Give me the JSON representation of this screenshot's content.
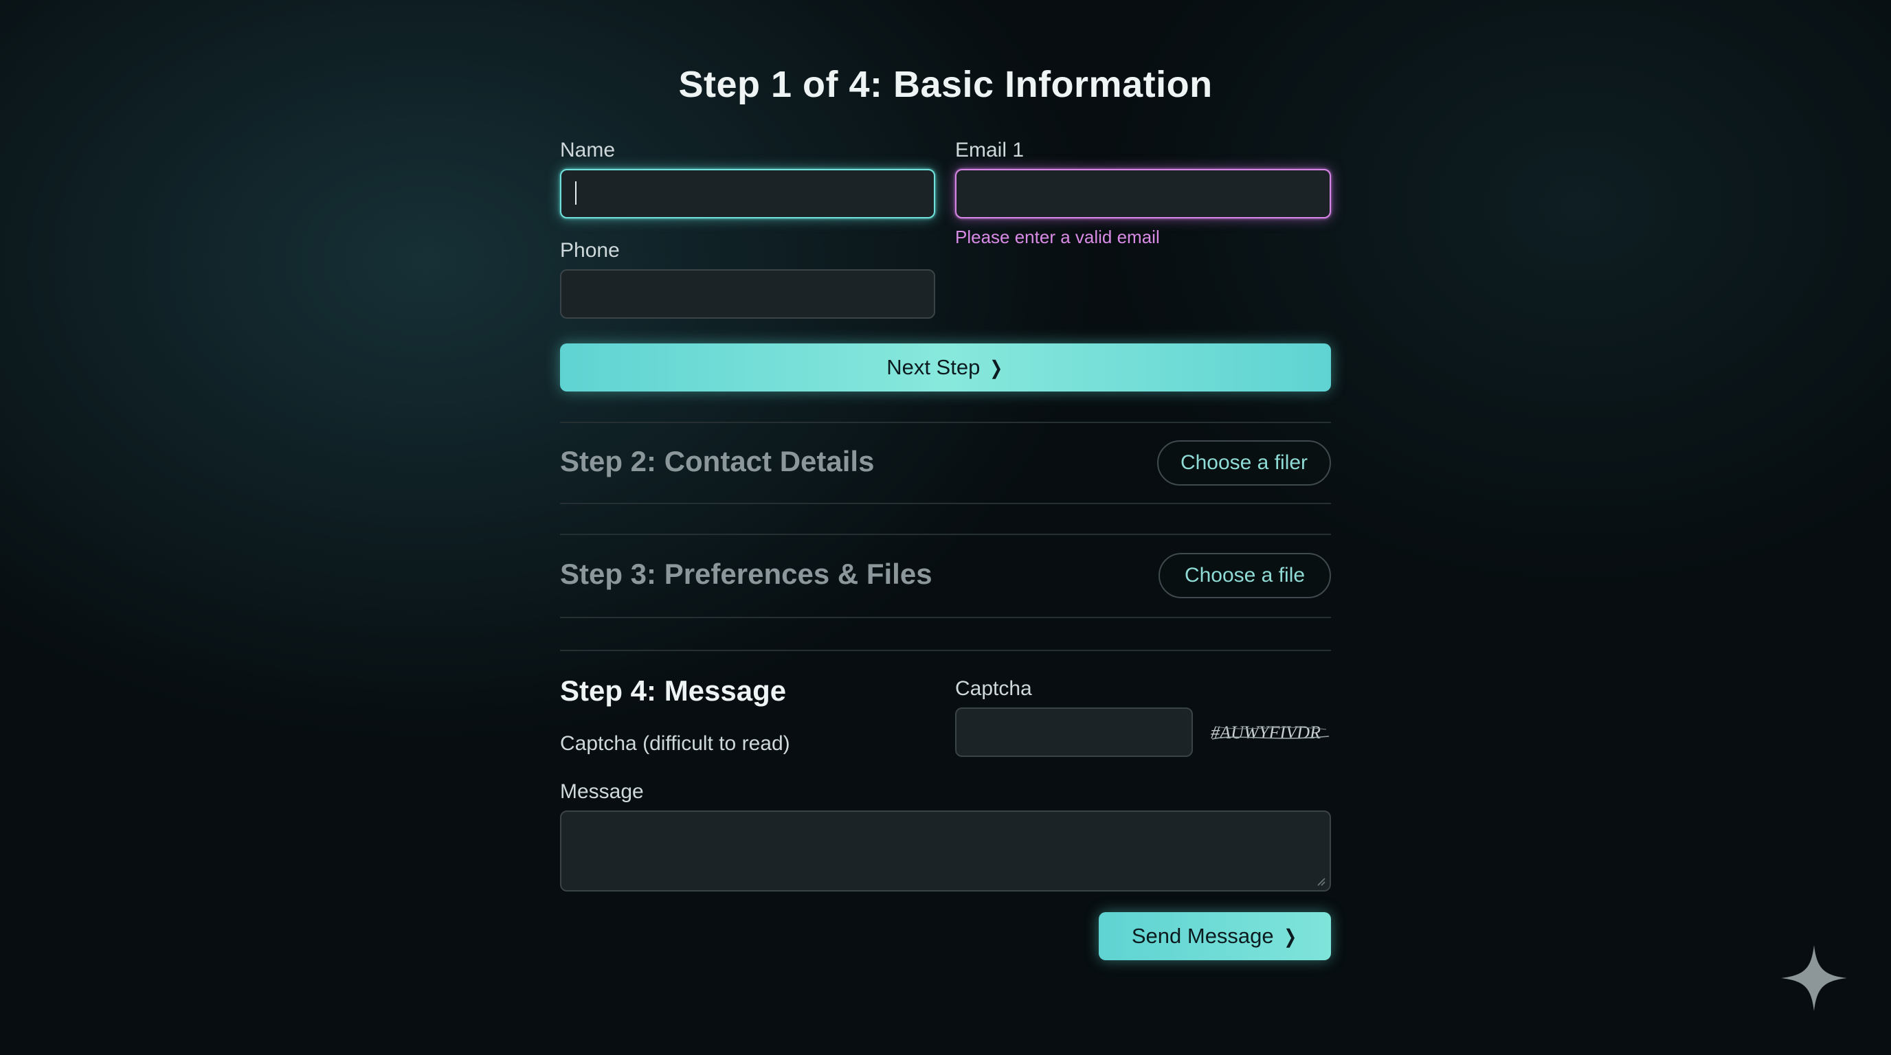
{
  "step1": {
    "title": "Step 1 of 4: Basic Information",
    "name_label": "Name",
    "name_value": "",
    "email_label": "Email 1",
    "email_value": "",
    "email_error": "Please enter a valid email",
    "phone_label": "Phone",
    "phone_value": "",
    "next_label": "Next Step"
  },
  "step2": {
    "title": "Step 2: Contact Details",
    "button_label": "Choose a filer"
  },
  "step3": {
    "title": "Step 3: Preferences & Files",
    "button_label": "Choose a file"
  },
  "step4": {
    "title": "Step 4: Message",
    "captcha_hint": "Captcha (difficult to read)",
    "captcha_label": "Captcha",
    "captcha_value": "",
    "captcha_text": "#AUWYFIVDR",
    "message_label": "Message",
    "message_value": "",
    "send_label": "Send Message"
  },
  "icons": {
    "chevron": "chevron-right-icon",
    "watermark": "sparkle-icon"
  },
  "colors": {
    "accent": "#6fe0da",
    "error": "#d98be6",
    "background": "#070d10"
  }
}
